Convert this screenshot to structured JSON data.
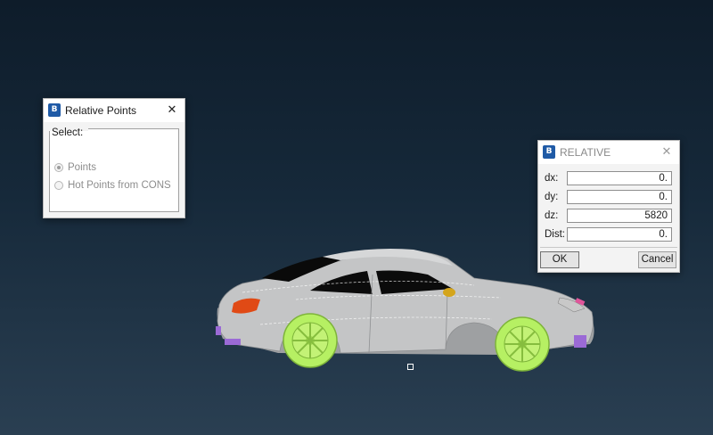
{
  "relative_points_dialog": {
    "title": "Relative Points",
    "group_label": "Select:",
    "options": [
      {
        "label": "Points",
        "checked": true,
        "enabled": false
      },
      {
        "label": "Hot Points from CONS",
        "checked": false,
        "enabled": false
      }
    ]
  },
  "relative_dialog": {
    "title": "RELATIVE",
    "fields": [
      {
        "label": "dx:",
        "value": "0."
      },
      {
        "label": "dy:",
        "value": "0."
      },
      {
        "label": "dz:",
        "value": "5820"
      },
      {
        "label": "Dist:",
        "value": "0."
      }
    ],
    "ok_label": "OK",
    "cancel_label": "Cancel"
  },
  "icons": {
    "app_icon": "ansa-logo-icon",
    "close": "close-icon"
  },
  "colors": {
    "background_top": "#0e1c2a",
    "background_bottom": "#2a3f52",
    "car_body": "#c7c7c7",
    "wheels": "#b6f063",
    "lights": "#e04a15",
    "highlight_parts": "#9b6ad6",
    "app_icon": "#1f5aa6"
  }
}
